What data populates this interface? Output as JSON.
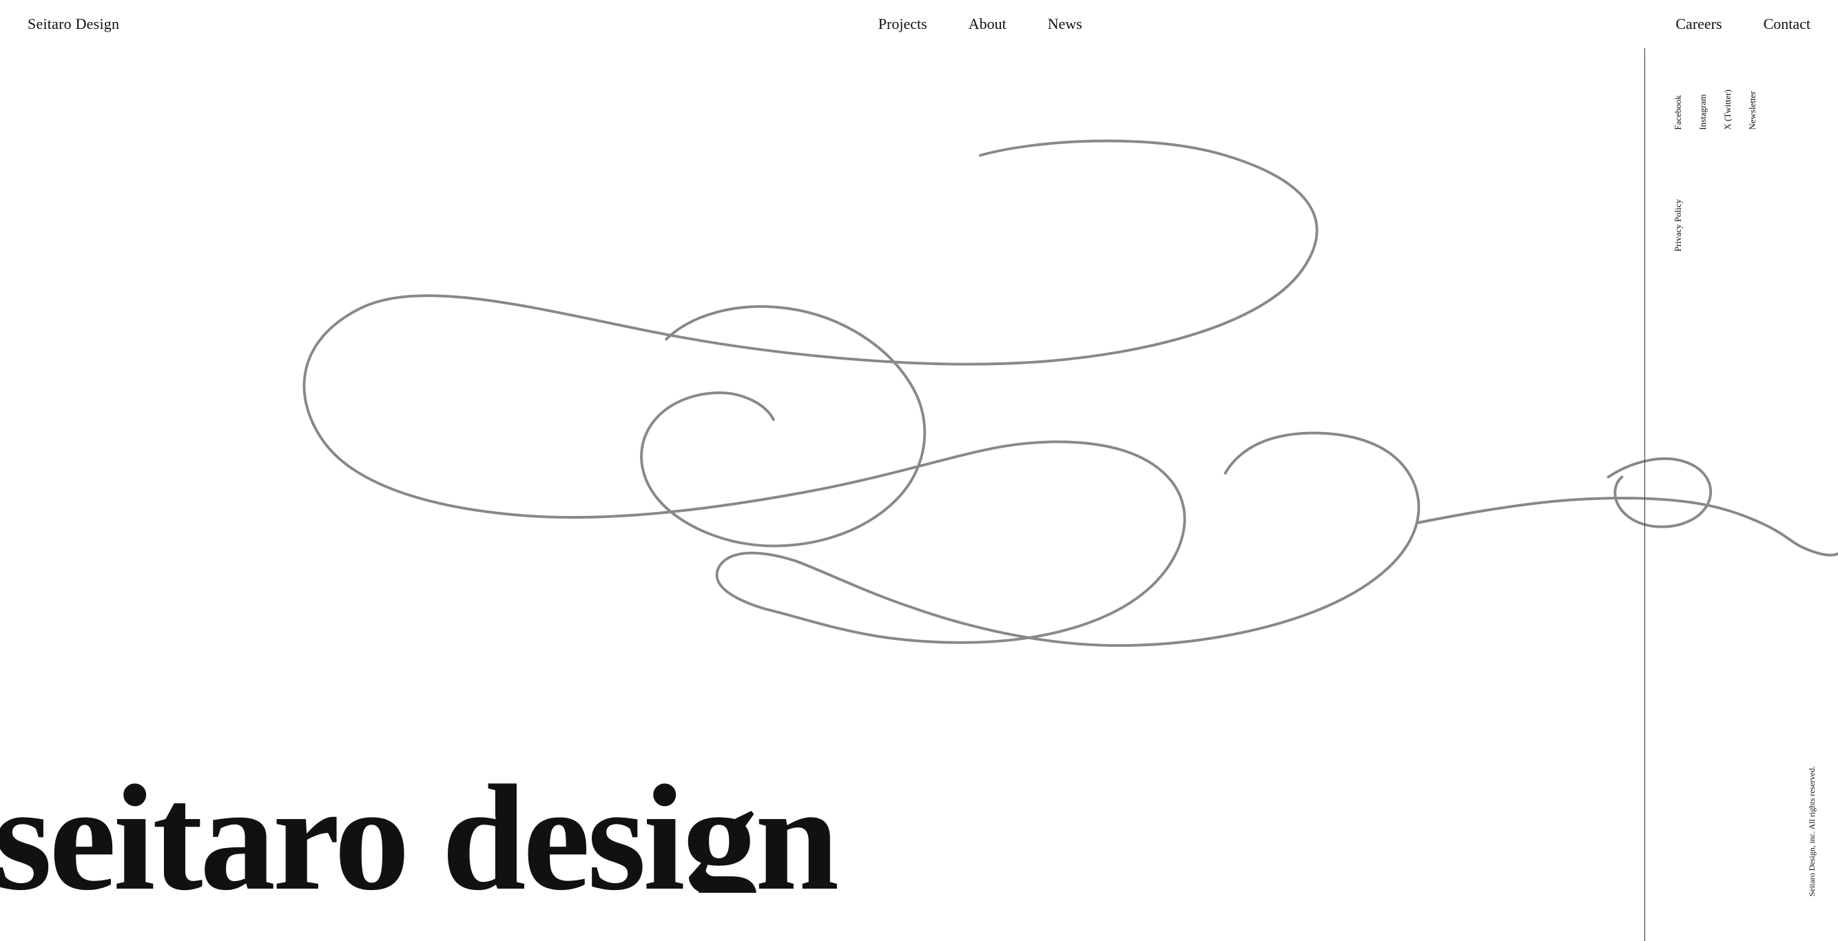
{
  "header": {
    "logo": "Seitaro Design",
    "nav_center": [
      {
        "label": "Projects",
        "href": "#"
      },
      {
        "label": "About",
        "href": "#"
      },
      {
        "label": "News",
        "href": "#"
      }
    ],
    "nav_right": [
      {
        "label": "Careers",
        "href": "#"
      },
      {
        "label": "Contact",
        "href": "#"
      }
    ]
  },
  "main": {
    "big_title": "seitaro design"
  },
  "right_panel": {
    "social_links": [
      {
        "label": "Facebook",
        "href": "#"
      },
      {
        "label": "Instagram",
        "href": "#"
      },
      {
        "label": "X (Twitter)",
        "href": "#"
      },
      {
        "label": "Newsletter",
        "href": "#"
      }
    ],
    "policy_link": "Privacy Policy",
    "copyright": "Seitaro Design, inc. All rights reserved."
  }
}
